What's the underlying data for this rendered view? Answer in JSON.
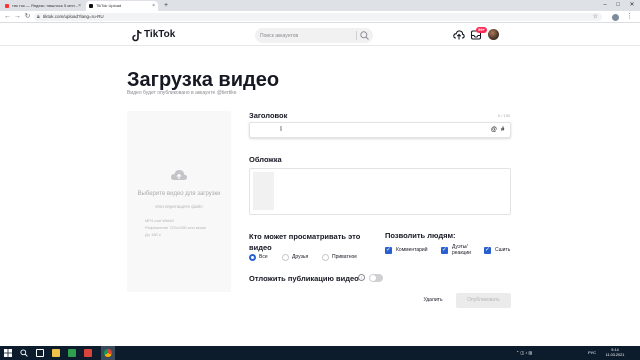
{
  "browser": {
    "tabs": [
      {
        "title": "тик ток — Яндекс: нашлось 5 млн…",
        "active": false
      },
      {
        "title": "TikTok Upload",
        "active": true
      }
    ],
    "new_tab": "+",
    "url": "tiktok.com/upload?lang=ru-RU",
    "window_controls": [
      "–",
      "□",
      "✕"
    ]
  },
  "header": {
    "logo": "TikTok",
    "search_placeholder": "Поиск аккаунтов",
    "inbox_badge": "99+"
  },
  "page": {
    "title": "Загрузка видео",
    "subtitle": "Видео будет опубликовано в аккаунте @tiertike"
  },
  "dropzone": {
    "title": "Выберите видео для загрузки",
    "subtitle": "Или перетащите файл",
    "requirements": [
      "MP4 или WebM",
      "Разрешение 720x1280 или выше",
      "До 180 с"
    ]
  },
  "caption": {
    "label": "Заголовок",
    "counter": "0 / 150",
    "value": "",
    "mention": "@",
    "hashtag": "#"
  },
  "cover": {
    "label": "Обложка"
  },
  "privacy": {
    "label": "Кто может просматривать это видео",
    "options": [
      "Все",
      "Друзья",
      "Приватное"
    ],
    "selected": "Все"
  },
  "allow": {
    "label": "Позволить людям:",
    "options": [
      {
        "label": "Комментарий",
        "checked": true
      },
      {
        "label": "Дуэты/реакции",
        "checked": true
      },
      {
        "label": "Сшить",
        "checked": true
      }
    ]
  },
  "schedule": {
    "label": "Отложить публикацию видео",
    "info": "i",
    "enabled": false
  },
  "actions": {
    "cancel": "Удалить",
    "post": "Опубликовать"
  },
  "taskbar": {
    "lang": "РУС",
    "time": "9:14",
    "date": "11.03.2021"
  },
  "colors": {
    "accent": "#fe2c55",
    "checkbox": "#2a5fcf",
    "text": "#161823"
  }
}
